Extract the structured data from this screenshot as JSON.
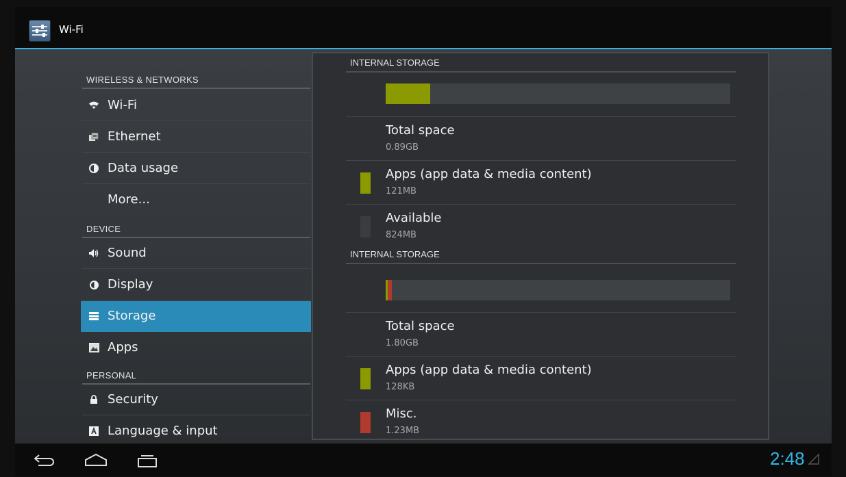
{
  "app": {
    "title": "Wi-Fi"
  },
  "sidebar": {
    "sections": [
      {
        "header": "WIRELESS & NETWORKS"
      },
      {
        "header": "DEVICE"
      },
      {
        "header": "PERSONAL"
      }
    ],
    "items": [
      {
        "label": "Wi-Fi",
        "icon": "wifi-icon"
      },
      {
        "label": "Ethernet",
        "icon": "ethernet-icon"
      },
      {
        "label": "Data usage",
        "icon": "data-usage-icon"
      },
      {
        "label": "More...",
        "icon": ""
      },
      {
        "label": "Sound",
        "icon": "speaker-icon"
      },
      {
        "label": "Display",
        "icon": "brightness-icon"
      },
      {
        "label": "Storage",
        "icon": "storage-icon",
        "selected": true
      },
      {
        "label": "Apps",
        "icon": "apps-icon"
      },
      {
        "label": "Security",
        "icon": "lock-icon"
      },
      {
        "label": "Language & input",
        "icon": "language-icon"
      }
    ]
  },
  "storage": [
    {
      "header": "INTERNAL STORAGE",
      "usage_fraction": 0.13,
      "usage_segments": [
        {
          "color": "#8a9a00",
          "fraction": 0.13
        }
      ],
      "rows": [
        {
          "title": "Total space",
          "value": "0.89GB",
          "color": ""
        },
        {
          "title": "Apps (app data & media content)",
          "value": "121MB",
          "color": "#8a9a00"
        },
        {
          "title": "Available",
          "value": "824MB",
          "color": "#3a3d40"
        }
      ]
    },
    {
      "header": "INTERNAL STORAGE",
      "usage_segments": [
        {
          "color": "#8a9a00",
          "fraction": 0.004
        },
        {
          "color": "#b03a2e",
          "fraction": 0.012
        }
      ],
      "rows": [
        {
          "title": "Total space",
          "value": "1.80GB",
          "color": ""
        },
        {
          "title": "Apps (app data & media content)",
          "value": "128KB",
          "color": "#8a9a00"
        },
        {
          "title": "Misc.",
          "value": "1.23MB",
          "color": "#b03a2e"
        }
      ]
    }
  ],
  "statusbar": {
    "time": "2:48"
  },
  "colors": {
    "accent": "#33b5e5",
    "selected": "#2a8bb8"
  }
}
